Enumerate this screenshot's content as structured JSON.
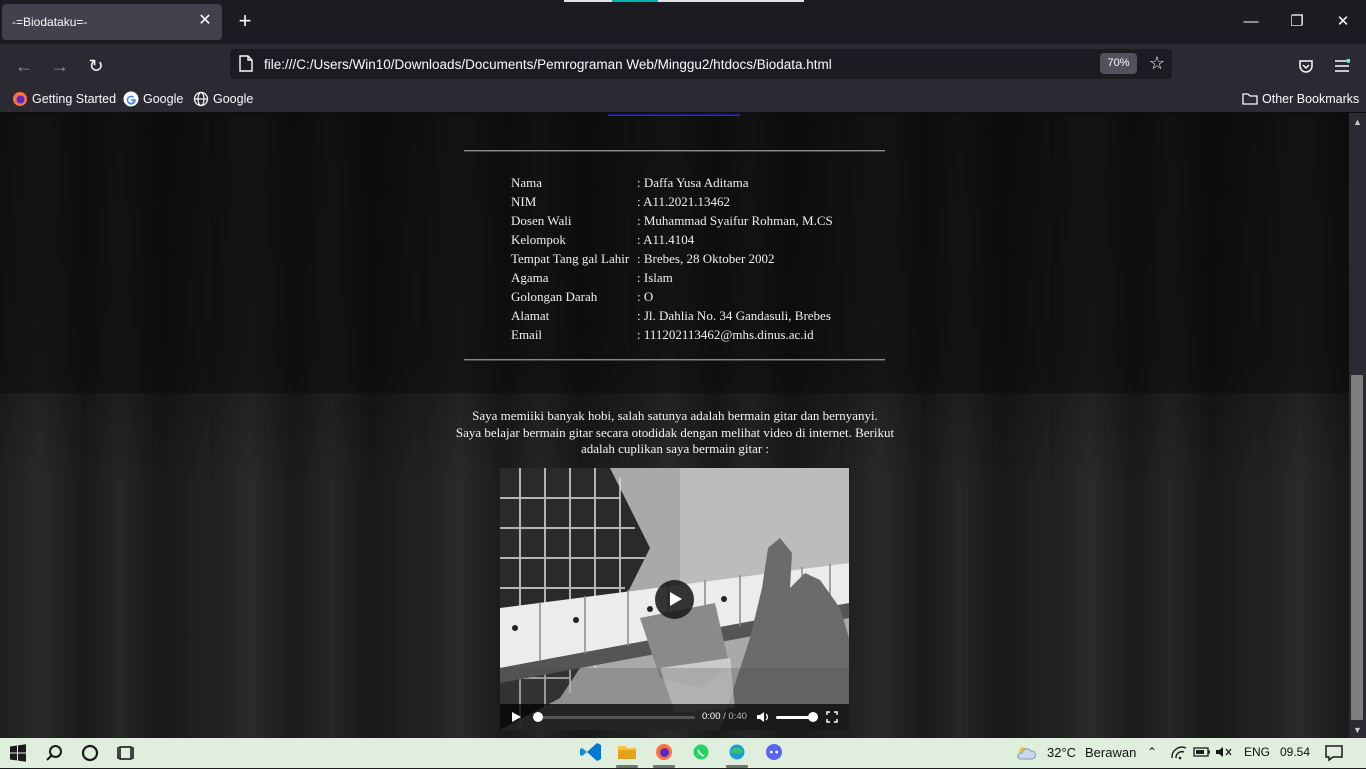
{
  "browser": {
    "tab_title": "-=Biodataku=-",
    "url": "file:///C:/Users/Win10/Downloads/Documents/Pemrograman Web/Minggu2/htdocs/Biodata.html",
    "zoom": "70%",
    "bookmarks": [
      {
        "label": "Getting Started",
        "icon": "firefox-icon"
      },
      {
        "label": "Google",
        "icon": "google-icon"
      },
      {
        "label": "Google",
        "icon": "globe-icon"
      }
    ],
    "other_bookmarks": "Other Bookmarks"
  },
  "biodata": [
    {
      "key": "Nama",
      "value": ": Daffa Yusa Aditama"
    },
    {
      "key": "NIM",
      "value": ": A11.2021.13462"
    },
    {
      "key": "Dosen Wali",
      "value": ": Muhammad Syaifur Rohman, M.CS"
    },
    {
      "key": "Kelompok",
      "value": ": A11.4104"
    },
    {
      "key": "Tempat Tang gal Lahir",
      "value": ": Brebes, 28 Oktober 2002"
    },
    {
      "key": "Agama",
      "value": ": Islam"
    },
    {
      "key": "Golongan Darah",
      "value": ": O"
    },
    {
      "key": "Alamat",
      "value": ": Jl. Dahlia No. 34 Gandasuli, Brebes"
    },
    {
      "key": "Email",
      "value": ": 111202113462@mhs.dinus.ac.id"
    }
  ],
  "hobby": {
    "line1": "Saya memiiki banyak hobi, salah satunya adalah bermain gitar dan bernyanyi.",
    "line2": "Saya belajar bermain gitar secara otodidak dengan melihat video di internet. Berikut",
    "line3": "adalah cuplikan saya bermain gitar :"
  },
  "video": {
    "current_time": "0:00",
    "separator": " / ",
    "duration": "0:40",
    "progress": 0,
    "volume": 1
  },
  "taskbar": {
    "apps": [
      "vscode-icon",
      "file-explorer-icon",
      "firefox-icon",
      "whatsapp-icon",
      "edge-icon",
      "discord-icon"
    ],
    "weather_temp": "32°C",
    "weather_desc": "Berawan",
    "language": "ENG",
    "time": "09.54"
  }
}
